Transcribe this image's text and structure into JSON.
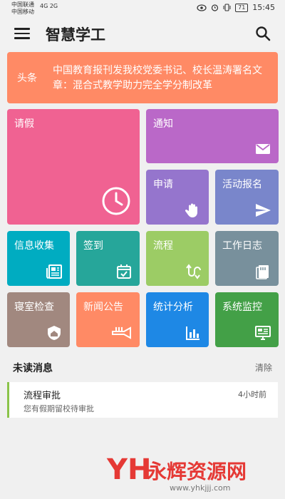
{
  "status_bar": {
    "carrier_1": "中国联通",
    "carrier_2": "中国移动",
    "signal": "4G 2G",
    "battery": "71",
    "time": "15:45"
  },
  "app_bar": {
    "title": "智慧学工"
  },
  "headline": {
    "tag": "头条",
    "text": "中国教育报刊发我校党委书记、校长温涛署名文章：混合式教学助力完全学分制改革"
  },
  "tiles": {
    "leave": {
      "label": "请假",
      "color": "#f06292",
      "icon": "clock-icon"
    },
    "notice": {
      "label": "通知",
      "color": "#ba68c8",
      "icon": "mail-icon"
    },
    "apply": {
      "label": "申请",
      "color": "#9575cd",
      "icon": "hand-icon"
    },
    "event_signup": {
      "label": "活动报名",
      "color": "#7986cb",
      "icon": "send-icon"
    },
    "info_collect": {
      "label": "信息收集",
      "color": "#00acc1",
      "icon": "news-icon"
    },
    "checkin": {
      "label": "签到",
      "color": "#26a69a",
      "icon": "calendar-check-icon"
    },
    "workflow": {
      "label": "流程",
      "color": "#9ccc65",
      "icon": "flow-icon"
    },
    "work_log": {
      "label": "工作日志",
      "color": "#78909c",
      "icon": "notebook-icon"
    },
    "dorm_check": {
      "label": "寝室检查",
      "color": "#a1887f",
      "icon": "home-shield-icon"
    },
    "news": {
      "label": "新闻公告",
      "color": "#ff8a65",
      "icon": "trumpet-icon"
    },
    "stats": {
      "label": "统计分析",
      "color": "#1e88e5",
      "icon": "bar-chart-icon"
    },
    "monitor": {
      "label": "系统监控",
      "color": "#43a047",
      "icon": "monitor-icon"
    }
  },
  "unread": {
    "title": "未读消息",
    "clear_label": "清除",
    "messages": [
      {
        "title": "流程审批",
        "time": "4小时前",
        "subtitle": "您有假期留校待审批"
      }
    ]
  },
  "watermark": {
    "logo_text": "YH",
    "name": "永辉资源网",
    "url": "www.yhkjjj.com"
  }
}
